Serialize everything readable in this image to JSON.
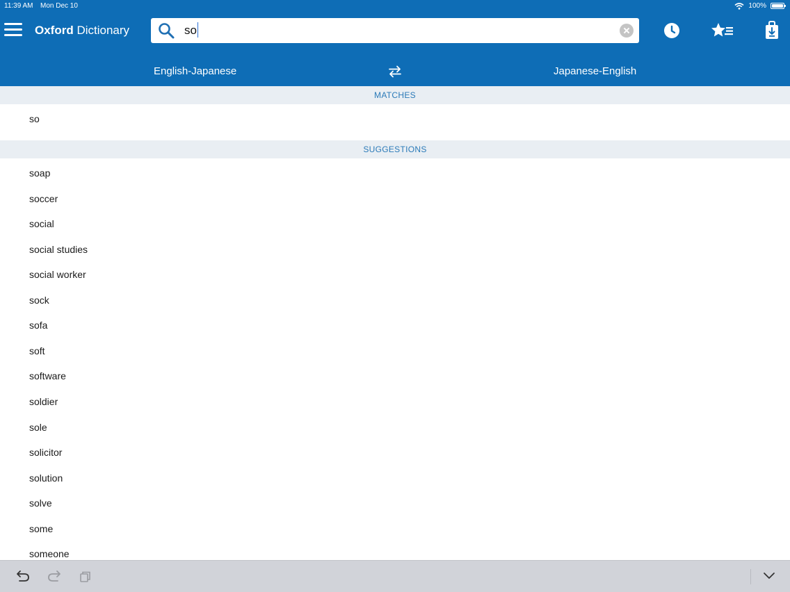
{
  "status_bar": {
    "time": "11:39 AM",
    "date": "Mon Dec 10",
    "battery": "100%"
  },
  "header": {
    "title_bold": "Oxford",
    "title_regular": "Dictionary",
    "search": {
      "value": "so",
      "placeholder": ""
    },
    "icons": [
      "menu-icon",
      "search-icon",
      "clear-icon",
      "history-clock-icon",
      "favorites-star-icon",
      "download-icon"
    ]
  },
  "languages": {
    "left": "English-Japanese",
    "right": "Japanese-English",
    "swap_icon": "swap-arrows-icon"
  },
  "matches": {
    "header": "MATCHES",
    "items": [
      "so"
    ]
  },
  "suggestions": {
    "header": "SUGGESTIONS",
    "items": [
      "soap",
      "soccer",
      "social",
      "social studies",
      "social worker",
      "sock",
      "sofa",
      "soft",
      "software",
      "soldier",
      "sole",
      "solicitor",
      "solution",
      "solve",
      "some",
      "someone"
    ]
  },
  "keyboard_bar": {
    "icons": [
      "undo-icon",
      "redo-icon",
      "paste-icon",
      "hide-keyboard-chevron-icon"
    ]
  },
  "colors": {
    "header_bg": "#0e6db6",
    "section_header_bg": "#e9eef3",
    "section_header_text": "#2b7ab8",
    "keyboard_bar_bg": "#d1d3d9"
  }
}
